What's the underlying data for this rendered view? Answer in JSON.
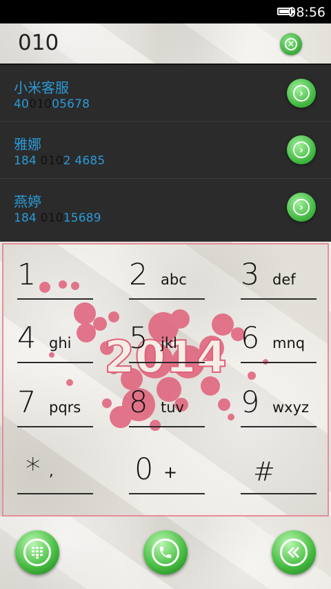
{
  "status_bar": {
    "time": "08:56",
    "battery_icon": "battery-icon"
  },
  "input": {
    "number": "010"
  },
  "suggestions": [
    {
      "name": "小米客服",
      "number_before": "40",
      "number_match": "010",
      "number_after": "05678"
    },
    {
      "name": "雅娜",
      "number_before": "184 ",
      "number_match": "010",
      "number_after": "2 4685"
    },
    {
      "name": "燕婷",
      "number_before": "184 ",
      "number_match": "010",
      "number_after": "15689"
    }
  ],
  "keypad": {
    "keys": [
      {
        "digit": "1",
        "letters": ""
      },
      {
        "digit": "2",
        "letters": "abc"
      },
      {
        "digit": "3",
        "letters": "def"
      },
      {
        "digit": "4",
        "letters": "ghi"
      },
      {
        "digit": "5",
        "letters": "jkl"
      },
      {
        "digit": "6",
        "letters": "mnq"
      },
      {
        "digit": "7",
        "letters": "pqrs"
      },
      {
        "digit": "8",
        "letters": "tuv"
      },
      {
        "digit": "9",
        "letters": "wxyz"
      },
      {
        "digit": "*",
        "letters": ","
      },
      {
        "digit": "0",
        "letters": "+"
      },
      {
        "digit": "#",
        "letters": ""
      }
    ],
    "background_text": "2014",
    "accent_color": "#e0607a"
  },
  "bottom_bar": {
    "left_icon": "dialpad-icon",
    "center_icon": "phone-icon",
    "right_icon": "double-chevron-left-icon",
    "button_color": "#4cc046"
  }
}
